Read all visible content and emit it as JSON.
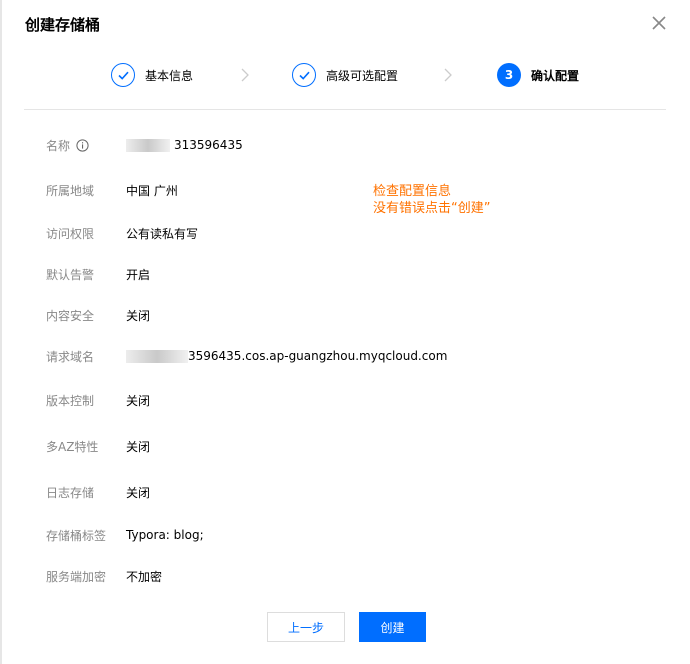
{
  "dialog": {
    "title": "创建存储桶",
    "close_icon": "close-icon"
  },
  "steps": [
    {
      "label": "基本信息",
      "status": "done",
      "icon": "check-icon"
    },
    {
      "label": "高级可选配置",
      "status": "done",
      "icon": "check-icon"
    },
    {
      "label": "确认配置",
      "status": "active",
      "number": "3"
    }
  ],
  "fields": {
    "name": {
      "label": "名称",
      "value": "313596435",
      "info_icon": "info-icon"
    },
    "region": {
      "label": "所属地域",
      "value": "中国 广州"
    },
    "access": {
      "label": "访问权限",
      "value": "公有读私有写"
    },
    "alarm": {
      "label": "默认告警",
      "value": "开启"
    },
    "content_security": {
      "label": "内容安全",
      "value": "关闭"
    },
    "domain": {
      "label": "请求域名",
      "value": "3596435.cos.ap-guangzhou.myqcloud.com"
    },
    "versioning": {
      "label": "版本控制",
      "value": "关闭"
    },
    "multi_az": {
      "label": "多AZ特性",
      "value": "关闭"
    },
    "logging": {
      "label": "日志存储",
      "value": "关闭"
    },
    "tags": {
      "label": "存储桶标签",
      "value": "Typora: blog;"
    },
    "encryption": {
      "label": "服务端加密",
      "value": "不加密"
    }
  },
  "annotation": {
    "line1": "检查配置信息",
    "line2": "没有错误点击“创建”"
  },
  "buttons": {
    "prev": "上一步",
    "create": "创建"
  },
  "colors": {
    "primary": "#006eff",
    "annotation": "#ff7200",
    "label": "#888888"
  }
}
